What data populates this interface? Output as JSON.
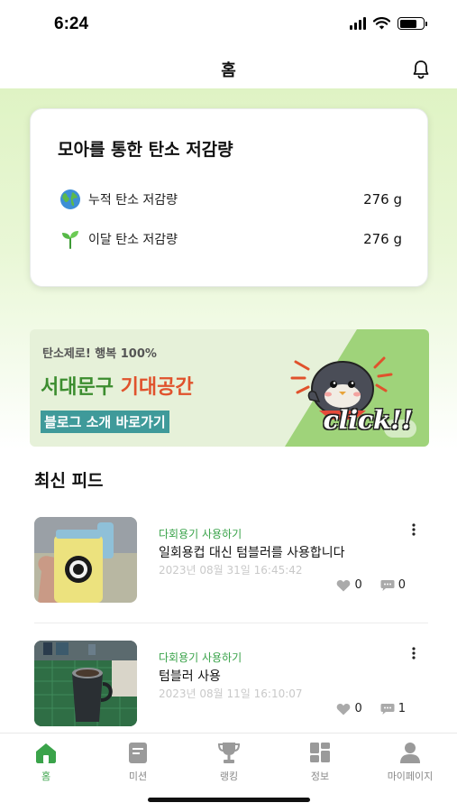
{
  "status_bar": {
    "time": "6:24",
    "battery_level": 0.75
  },
  "header": {
    "title": "홈",
    "bell_icon": "bell-icon"
  },
  "carbon_card": {
    "title": "모아를 통한 탄소 저감량",
    "rows": [
      {
        "icon": "globe-icon",
        "label": "누적 탄소 저감량",
        "value": "276 g"
      },
      {
        "icon": "sprout-icon",
        "label": "이달 탄소 저감량",
        "value": "276 g"
      }
    ]
  },
  "banner": {
    "small_text": "탄소제로! 행복 100%",
    "big_text_green": "서대문구",
    "big_text_red": "기대공간",
    "link_text": "블로그 소개 바로가기",
    "click_text": "click!!",
    "colors": {
      "green": "#3c8d2f",
      "red": "#e0522c",
      "link_bg": "#3f9a9a"
    }
  },
  "feed": {
    "title": "최신 피드",
    "items": [
      {
        "category": "다회용기 사용하기",
        "text": "일회용컵 대신 텀블러를 사용합니다",
        "date": "2023년 08월 31일 16:45:42",
        "likes": "0",
        "comments": "0",
        "thumb": "tumbler-photo"
      },
      {
        "category": "다회용기 사용하기",
        "text": "텀블러 사용",
        "date": "2023년 08월 11일 16:10:07",
        "likes": "0",
        "comments": "1",
        "thumb": "steel-cup-photo"
      }
    ]
  },
  "bottom_nav": {
    "items": [
      {
        "label": "홈",
        "icon": "home-icon",
        "active": true
      },
      {
        "label": "미션",
        "icon": "mission-icon",
        "active": false
      },
      {
        "label": "랭킹",
        "icon": "trophy-icon",
        "active": false
      },
      {
        "label": "정보",
        "icon": "info-grid-icon",
        "active": false
      },
      {
        "label": "마이페이지",
        "icon": "person-icon",
        "active": false
      }
    ],
    "active_color": "#3aa34a",
    "inactive_color": "#9a9a9a"
  }
}
